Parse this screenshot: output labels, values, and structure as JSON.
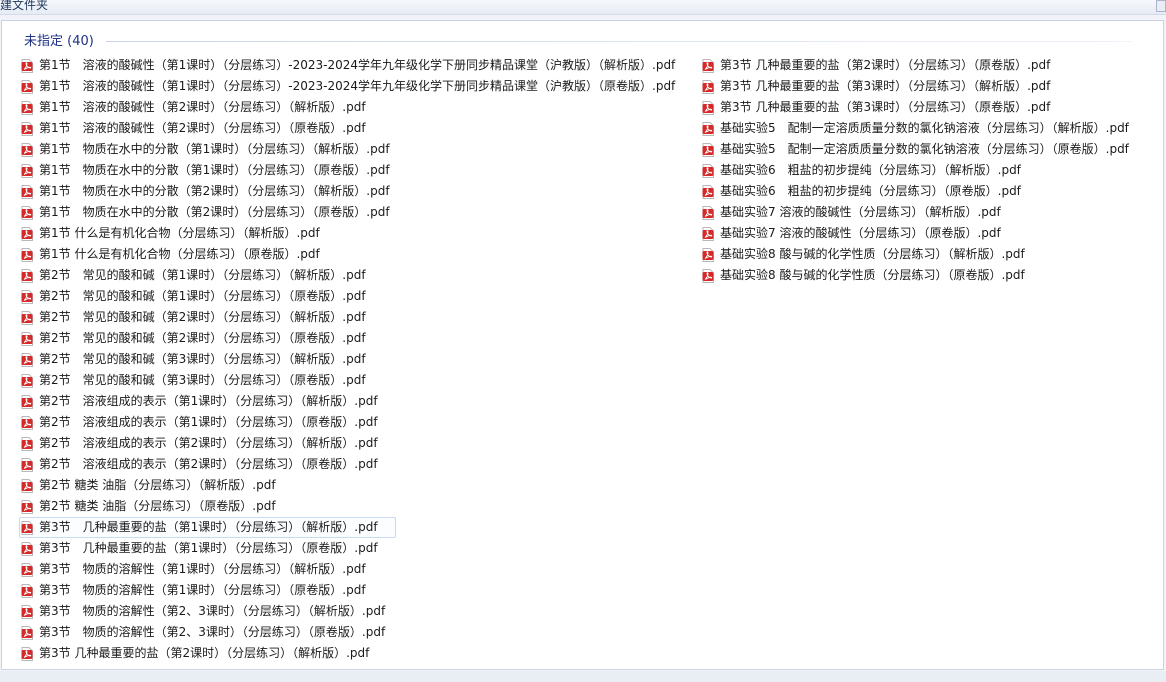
{
  "toolbar": {
    "new_folder_label": "建文件夹"
  },
  "group": {
    "header": "未指定 (40)"
  },
  "files_left": [
    "第1节　溶液的酸碱性（第1课时）（分层练习）-2023-2024学年九年级化学下册同步精品课堂（沪教版）（解析版）.pdf",
    "第1节　溶液的酸碱性（第1课时）（分层练习）-2023-2024学年九年级化学下册同步精品课堂（沪教版）（原卷版）.pdf",
    "第1节　溶液的酸碱性（第2课时）（分层练习）（解析版）.pdf",
    "第1节　溶液的酸碱性（第2课时）（分层练习）（原卷版）.pdf",
    "第1节　物质在水中的分散（第1课时）（分层练习）（解析版）.pdf",
    "第1节　物质在水中的分散（第1课时）（分层练习）（原卷版）.pdf",
    "第1节　物质在水中的分散（第2课时）（分层练习）（解析版）.pdf",
    "第1节　物质在水中的分散（第2课时）（分层练习）（原卷版）.pdf",
    "第1节 什么是有机化合物（分层练习）（解析版）.pdf",
    "第1节 什么是有机化合物（分层练习）（原卷版）.pdf",
    "第2节　常见的酸和碱（第1课时）（分层练习）（解析版）.pdf",
    "第2节　常见的酸和碱（第1课时）（分层练习）（原卷版）.pdf",
    "第2节　常见的酸和碱（第2课时）（分层练习）（解析版）.pdf",
    "第2节　常见的酸和碱（第2课时）（分层练习）（原卷版）.pdf",
    "第2节　常见的酸和碱（第3课时）（分层练习）（解析版）.pdf",
    "第2节　常见的酸和碱（第3课时）（分层练习）（原卷版）.pdf",
    "第2节　溶液组成的表示（第1课时）（分层练习）（解析版）.pdf",
    "第2节　溶液组成的表示（第1课时）（分层练习）（原卷版）.pdf",
    "第2节　溶液组成的表示（第2课时）（分层练习）（解析版）.pdf",
    "第2节　溶液组成的表示（第2课时）（分层练习）（原卷版）.pdf",
    "第2节 糖类 油脂（分层练习）（解析版）.pdf",
    "第2节 糖类 油脂（分层练习）（原卷版）.pdf",
    "第3节　几种最重要的盐（第1课时）（分层练习）（解析版）.pdf",
    "第3节　几种最重要的盐（第1课时）（分层练习）（原卷版）.pdf",
    "第3节　物质的溶解性（第1课时）（分层练习）（解析版）.pdf",
    "第3节　物质的溶解性（第1课时）（分层练习）（原卷版）.pdf",
    "第3节　物质的溶解性（第2、3课时）（分层练习）（解析版）.pdf",
    "第3节　物质的溶解性（第2、3课时）（分层练习）（原卷版）.pdf",
    "第3节 几种最重要的盐（第2课时）（分层练习）（解析版）.pdf"
  ],
  "files_right": [
    "第3节 几种最重要的盐（第2课时）（分层练习）（原卷版）.pdf",
    "第3节 几种最重要的盐（第3课时）（分层练习）（解析版）.pdf",
    "第3节 几种最重要的盐（第3课时）（分层练习）（原卷版）.pdf",
    "基础实验5　配制一定溶质质量分数的氯化钠溶液（分层练习）（解析版）.pdf",
    "基础实验5　配制一定溶质质量分数的氯化钠溶液（分层练习）（原卷版）.pdf",
    "基础实验6　粗盐的初步提纯（分层练习）（解析版）.pdf",
    "基础实验6　粗盐的初步提纯（分层练习）（原卷版）.pdf",
    "基础实验7 溶液的酸碱性（分层练习）（解析版）.pdf",
    "基础实验7 溶液的酸碱性（分层练习）（原卷版）.pdf",
    "基础实验8 酸与碱的化学性质（分层练习）（解析版）.pdf",
    "基础实验8 酸与碱的化学性质（分层练习）（原卷版）.pdf"
  ],
  "selected_index_left": 22,
  "colors": {
    "header_text": "#1e3287",
    "pdf_red": "#d42a2a",
    "selection_border": "#c9dbf2"
  },
  "icon": "pdf-file-icon"
}
